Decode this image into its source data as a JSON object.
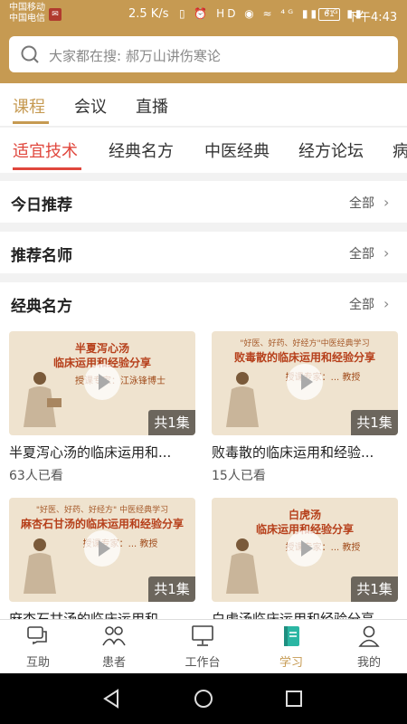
{
  "status": {
    "carrier_1": "中国移动",
    "carrier_2": "中国电信",
    "speed": "2.5 K/s",
    "icons": "▯ ⏰ HD ◉ ≈ ⁴ᴳ ▮▮ ²ᴳ ▮▮",
    "battery": "61",
    "time": "下午4:43"
  },
  "search": {
    "placeholder": "大家都在搜: 郝万山讲伤寒论"
  },
  "main_tabs": [
    "课程",
    "会议",
    "直播"
  ],
  "sub_tabs": [
    "适宜技术",
    "经典名方",
    "中医经典",
    "经方论坛",
    "病"
  ],
  "sections": [
    {
      "title": "今日推荐",
      "more": "全部"
    },
    {
      "title": "推荐名师",
      "more": "全部"
    },
    {
      "title": "经典名方",
      "more": "全部"
    }
  ],
  "courses": [
    {
      "title": "半夏泻心汤的临床运用和...",
      "views": "63人已看",
      "episodes": "共1集",
      "thumb_line1": "半夏泻心汤",
      "thumb_line2": "临床运用和经验分享",
      "thumb_teacher": "授课专家：江泳锋博士",
      "thumb_small": ""
    },
    {
      "title": "败毒散的临床运用和经验...",
      "views": "15人已看",
      "episodes": "共1集",
      "thumb_line1": "败毒散的临床运用和经验分享",
      "thumb_line2": "",
      "thumb_teacher": "授课专家：... 教授",
      "thumb_small": "\"好医、好药、好经方\"中医经典学习"
    },
    {
      "title": "麻杏石甘汤的临床运用和...",
      "views": "",
      "episodes": "共1集",
      "thumb_line1": "麻杏石甘汤的临床运用和经验分享",
      "thumb_line2": "",
      "thumb_teacher": "授课专家：... 教授",
      "thumb_small": "\"好医、好药、好经方\" 中医经典学习"
    },
    {
      "title": "白虎汤临床运用和经验分享",
      "views": "",
      "episodes": "共1集",
      "thumb_line1": "白虎汤",
      "thumb_line2": "临床运用和经验分享",
      "thumb_teacher": "授课专家：... 教授",
      "thumb_small": ""
    }
  ],
  "bottom_nav": [
    "互助",
    "患者",
    "工作台",
    "学习",
    "我的"
  ],
  "colors": {
    "brand": "#c69a52",
    "accent_red": "#e0463c"
  }
}
